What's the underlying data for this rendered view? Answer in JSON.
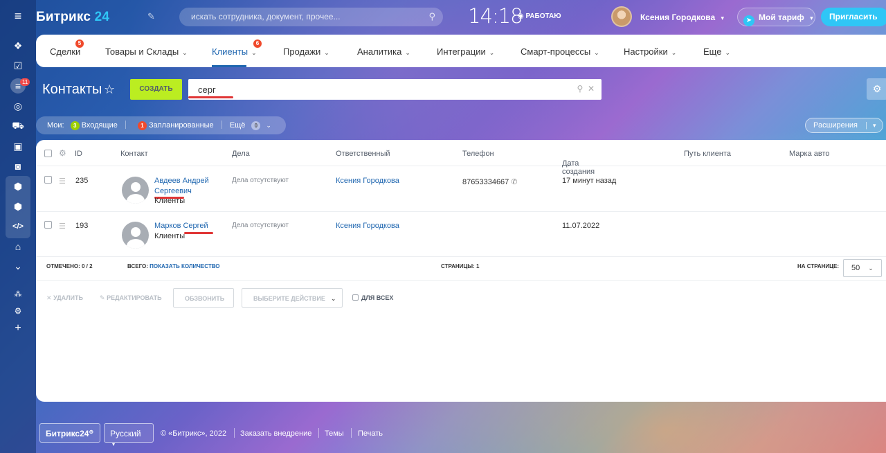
{
  "header": {
    "logo_main": "Битрикс",
    "logo_num": "24",
    "search_placeholder": "искать сотрудника, документ, прочее...",
    "time": "14:18",
    "work_status": "РАБОТАЮ",
    "user_name": "Ксения Городкова",
    "tariff_label": "Мой тариф",
    "invite_label": "Пригласить"
  },
  "sidebar": {
    "badge": "11"
  },
  "nav": {
    "items": [
      {
        "label": "Сделки",
        "badge": "5"
      },
      {
        "label": "Товары и Склады"
      },
      {
        "label": "Клиенты",
        "badge": "6"
      },
      {
        "label": "Продажи"
      },
      {
        "label": "Аналитика"
      },
      {
        "label": "Интеграции"
      },
      {
        "label": "Смарт-процессы"
      },
      {
        "label": "Настройки"
      },
      {
        "label": "Еще"
      }
    ]
  },
  "page": {
    "title": "Контакты",
    "create_label": "СОЗДАТЬ",
    "filter_value": "серг"
  },
  "counters": {
    "mine_label": "Мои:",
    "incoming_count": "3",
    "incoming_label": "Входящие",
    "planned_count": "1",
    "planned_label": "Запланированные",
    "more_label": "Ещё",
    "more_count": "0",
    "extensions_label": "Расширения"
  },
  "table": {
    "columns": [
      "ID",
      "Контакт",
      "Дела",
      "Ответственный",
      "Телефон",
      "Дата создания",
      "Путь клиента",
      "Марка авто"
    ],
    "rows": [
      {
        "id": "235",
        "name_line1": "Авдеев Андрей",
        "name_line2": "Сергеевич",
        "type": "Клиенты",
        "deals": "Дела отсутствуют",
        "responsible": "Ксения Городкова",
        "phone": "87653334667",
        "created": "17 минут назад"
      },
      {
        "id": "193",
        "name_line1": "Марков Сергей",
        "name_line2": "",
        "type": "Клиенты",
        "deals": "Дела отсутствуют",
        "responsible": "Ксения Городкова",
        "phone": "",
        "created": "11.07.2022"
      }
    ]
  },
  "pager": {
    "marked_label": "ОТМЕЧЕНО:",
    "marked_value": "0 / 2",
    "total_label": "ВСЕГО:",
    "total_link": "ПОКАЗАТЬ КОЛИЧЕСТВО",
    "pages_label": "СТРАНИЦЫ:",
    "pages_value": "1",
    "per_page_label": "НА СТРАНИЦЕ:",
    "per_page_value": "50"
  },
  "actions": {
    "delete": "УДАЛИТЬ",
    "edit": "РЕДАКТИРОВАТЬ",
    "call": "ОБЗВОНИТЬ",
    "choose": "ВЫБЕРИТЕ ДЕЙСТВИЕ",
    "for_all": "ДЛЯ ВСЕХ"
  },
  "footer": {
    "logo": "Битрикс24",
    "language": "Русский",
    "copyright": "© «Битрикс», 2022",
    "order": "Заказать внедрение",
    "themes": "Темы",
    "print": "Печать"
  }
}
